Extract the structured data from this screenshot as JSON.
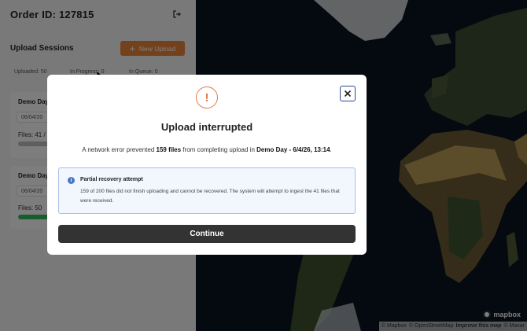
{
  "order": {
    "title": "Order ID: 127815"
  },
  "sessions": {
    "title": "Upload Sessions",
    "new_upload_label": "New Upload",
    "stats": {
      "uploaded": "Uploaded: 50",
      "in_progress": "In Progress: 0",
      "in_queue": "In Queue: 0"
    },
    "cards": [
      {
        "title": "Demo Day",
        "date": "06/04/20",
        "files": "Files: 41 /",
        "progress": 0.0,
        "bar_color": "#bdbdbd"
      },
      {
        "title": "Demo Day",
        "date": "06/04/20",
        "files": "Files: 50",
        "progress": 1.0,
        "bar_color": "#2ebd59"
      }
    ]
  },
  "map": {
    "logo": "mapbox",
    "attribution": {
      "mapbox": "© Mapbox",
      "osm": "© OpenStreetMap",
      "improve": "Improve this map",
      "maxar": "© Maxar"
    }
  },
  "modal": {
    "warning_glyph": "!",
    "title": "Upload interrupted",
    "desc_prefix": "A network error prevented ",
    "desc_count": "159 files",
    "desc_middle": " from completing upload in ",
    "desc_session": "Demo Day - 6/4/26, 13:14",
    "desc_suffix": ".",
    "info": {
      "glyph": "i",
      "title": "Partial recovery attempt",
      "body": "159 of 200 files did not finish uploading and cannot be recovered. The system will attempt to ingest the 41 files that were received."
    },
    "continue_label": "Continue"
  },
  "colors": {
    "accent": "#e8833a",
    "dark_button": "#333333",
    "info_border": "#a9bde6",
    "info_bg": "#f2f6fd",
    "warning": "#e07a4a",
    "success": "#2ebd59"
  },
  "icons": {
    "logout": "logout-icon",
    "plus": "plus-icon",
    "warning": "warning-icon",
    "close": "close-icon",
    "info": "info-icon"
  }
}
